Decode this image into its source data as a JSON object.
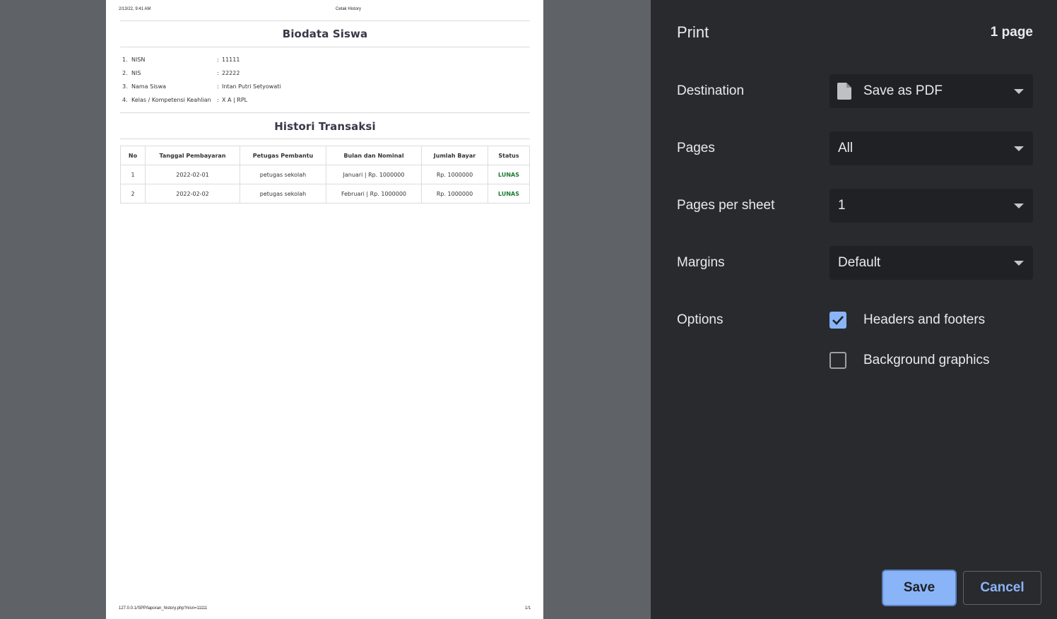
{
  "preview": {
    "header": {
      "date": "2/13/22, 9:41 AM",
      "title": "Cetak History"
    },
    "footer": {
      "url": "127.0.0.1/SPP/laporan_history.php?nisn=11111",
      "page": "1/1"
    },
    "biodata": {
      "heading": "Biodata Siswa",
      "rows": [
        {
          "num": "1.",
          "label": "NISN",
          "colon": ":",
          "value": "11111"
        },
        {
          "num": "2.",
          "label": "NIS",
          "colon": ":",
          "value": "22222"
        },
        {
          "num": "3.",
          "label": "Nama Siswa",
          "colon": ":",
          "value": "Intan Putri Setyowati"
        },
        {
          "num": "4.",
          "label": "Kelas / Kompetensi Keahlian",
          "colon": ":",
          "value": "X A | RPL"
        }
      ]
    },
    "history": {
      "heading": "Histori Transaksi",
      "columns": [
        "No",
        "Tanggal Pembayaran",
        "Petugas Pembantu",
        "Bulan dan Nominal",
        "Jumlah Bayar",
        "Status"
      ],
      "rows": [
        [
          "1",
          "2022-02-01",
          "petugas sekolah",
          "Januari | Rp. 1000000",
          "Rp. 1000000",
          "LUNAS"
        ],
        [
          "2",
          "2022-02-02",
          "petugas sekolah",
          "Februari | Rp. 1000000",
          "Rp. 1000000",
          "LUNAS"
        ]
      ],
      "status_color": "#1e7a34"
    }
  },
  "panel": {
    "title": "Print",
    "page_count": "1 page",
    "destination": {
      "label": "Destination",
      "value": "Save as PDF",
      "icon": "file-icon"
    },
    "pages": {
      "label": "Pages",
      "value": "All"
    },
    "pages_per_sheet": {
      "label": "Pages per sheet",
      "value": "1"
    },
    "margins": {
      "label": "Margins",
      "value": "Default"
    },
    "options": {
      "label": "Options",
      "headers_footers": {
        "label": "Headers and footers",
        "checked": true
      },
      "background_graphics": {
        "label": "Background graphics",
        "checked": false
      }
    },
    "buttons": {
      "save": "Save",
      "cancel": "Cancel"
    },
    "colors": {
      "accent": "#8ab4f8",
      "panel_bg": "#292a2d",
      "select_bg": "#202124"
    }
  }
}
